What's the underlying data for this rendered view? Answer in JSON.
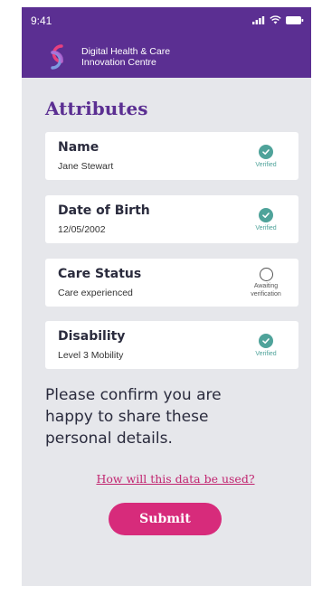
{
  "status_bar": {
    "time": "9:41",
    "icons": [
      "signal-icon",
      "wifi-icon",
      "battery-icon"
    ]
  },
  "header": {
    "org_line1": "Digital Health & Care",
    "org_line2": "Innovation Centre",
    "logo_icon": "dhcic-logo-icon"
  },
  "page": {
    "title": "Attributes"
  },
  "attributes": [
    {
      "label": "Name",
      "value": "Jane Stewart",
      "status": "Verified",
      "verified": true
    },
    {
      "label": "Date of Birth",
      "value": "12/05/2002",
      "status": "Verified",
      "verified": true
    },
    {
      "label": "Care Status",
      "value": "Care experienced",
      "status_line1": "Awaiting",
      "status_line2": "verification",
      "verified": false
    },
    {
      "label": "Disability",
      "value": "Level 3 Mobility",
      "status": "Verified",
      "verified": true
    }
  ],
  "confirm": {
    "text": "Please confirm you are happy to share these personal details."
  },
  "link": {
    "label": "How will this data be used?"
  },
  "submit": {
    "label": "Submit"
  },
  "colors": {
    "header_bg": "#5b2f92",
    "title": "#5b2f92",
    "verified": "#4fa39a",
    "accent": "#d72b7b",
    "background": "#e6e7eb"
  }
}
